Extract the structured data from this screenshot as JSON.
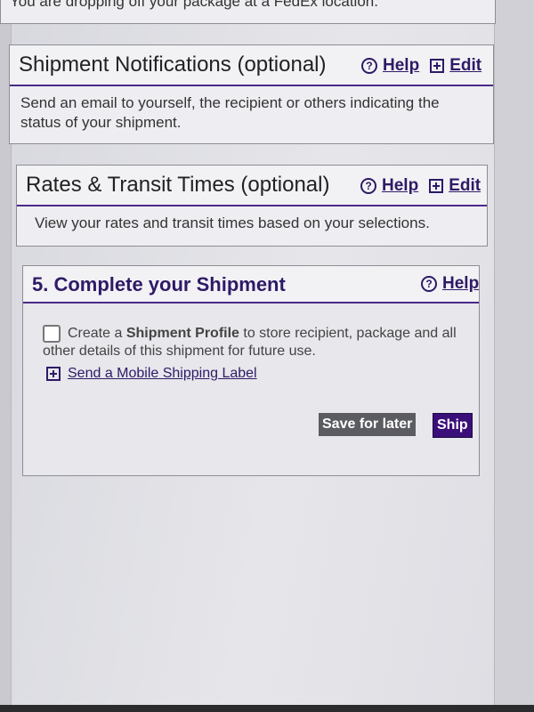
{
  "top": {
    "text": "You are dropping off your package at a FedEx location."
  },
  "shipment_notifications": {
    "title": "Shipment Notifications (optional)",
    "help_label": "Help",
    "edit_label": "Edit",
    "body": "Send an email to yourself, the recipient or others indicating the status of your shipment."
  },
  "rates_transit": {
    "title": "Rates & Transit Times (optional)",
    "help_label": "Help",
    "edit_label": "Edit",
    "body": "View your rates and transit times based on your selections."
  },
  "complete_shipment": {
    "title": "5. Complete your Shipment",
    "help_label": "Help",
    "profile_text_pre": "Create a ",
    "profile_text_bold": "Shipment Profile",
    "profile_text_post": " to store recipient, package and all other details of this shipment for future use.",
    "mobile_label_link": "Send a Mobile Shipping Label",
    "save_for_later": "Save for later",
    "ship": "Ship"
  }
}
